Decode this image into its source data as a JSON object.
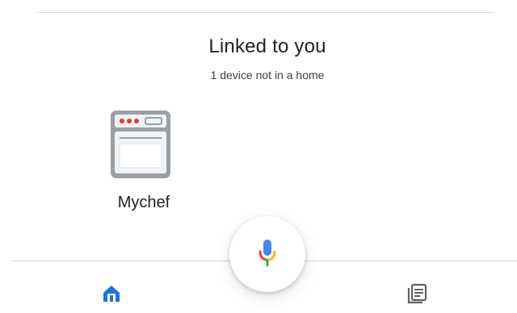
{
  "section": {
    "title": "Linked to you",
    "subtitle": "1 device not in a home"
  },
  "devices": [
    {
      "label": "Mychef",
      "icon": "oven-icon"
    }
  ],
  "assistant": {
    "icon": "microphone-icon"
  },
  "bottom_nav": {
    "items": [
      {
        "icon": "home-icon",
        "selected": true
      },
      {
        "icon": "feed-icon",
        "selected": false
      }
    ]
  },
  "colors": {
    "accent_blue": "#1a73e8",
    "oven_red": "#e53935",
    "oven_body": "#9aa0a6",
    "mic_red": "#ea4335",
    "mic_yellow": "#fbbc04",
    "mic_blue": "#4285f4",
    "text_primary": "#202124",
    "icon_grey": "#5f6368"
  }
}
